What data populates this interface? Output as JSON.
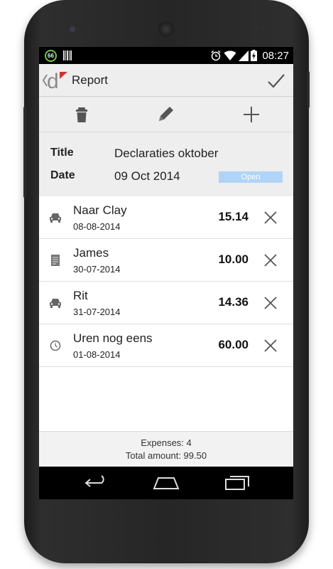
{
  "status_bar": {
    "badge": "66",
    "time": "08:27"
  },
  "action_bar": {
    "title": "Report"
  },
  "toolbar": {
    "icons": [
      "trash-icon",
      "pencil-icon",
      "plus-icon"
    ]
  },
  "report": {
    "title_label": "Title",
    "title_value": "Declaraties oktober",
    "date_label": "Date",
    "date_value": "09 Oct 2014",
    "status": "Open"
  },
  "expenses": [
    {
      "icon": "car-icon",
      "name": "Naar Clay",
      "date": "08-08-2014",
      "amount": "15.14"
    },
    {
      "icon": "receipt-icon",
      "name": "James",
      "date": "30-07-2014",
      "amount": "10.00"
    },
    {
      "icon": "car-icon",
      "name": "Rit",
      "date": "31-07-2014",
      "amount": "14.36"
    },
    {
      "icon": "clock-icon",
      "name": "Uren nog eens",
      "date": "01-08-2014",
      "amount": "60.00"
    }
  ],
  "footer": {
    "expenses_count": "Expenses: 4",
    "total_amount": "Total amount: 99.50"
  },
  "colors": {
    "accent": "#d32f2f",
    "status_pill": "#b0d4f7",
    "action_bar_bg": "#eeeeee"
  }
}
